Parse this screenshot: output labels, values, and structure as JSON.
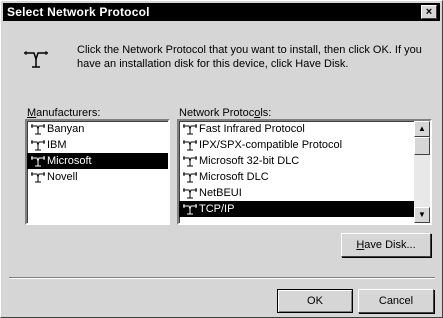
{
  "window": {
    "title": "Select Network Protocol",
    "close_label": "×"
  },
  "instructions": "Click the Network Protocol that you want to install, then click OK. If you have an installation disk for this device, click Have Disk.",
  "manufacturers": {
    "label_prefix": "",
    "label_underlined": "M",
    "label_rest": "anufacturers:",
    "items": [
      {
        "label": "Banyan",
        "icon": "network-protocol-icon"
      },
      {
        "label": "IBM",
        "icon": "network-protocol-icon"
      },
      {
        "label": "Microsoft",
        "icon": "network-protocol-icon"
      },
      {
        "label": "Novell",
        "icon": "network-protocol-icon"
      }
    ],
    "selected": "Microsoft"
  },
  "protocols": {
    "label_prefix": "Network Protoc",
    "label_underlined": "o",
    "label_rest": "ls:",
    "items": [
      {
        "label": "Fast Infrared Protocol",
        "icon": "network-protocol-icon"
      },
      {
        "label": "IPX/SPX-compatible Protocol",
        "icon": "network-protocol-icon"
      },
      {
        "label": "Microsoft 32-bit DLC",
        "icon": "network-protocol-icon"
      },
      {
        "label": "Microsoft DLC",
        "icon": "network-protocol-icon"
      },
      {
        "label": "NetBEUI",
        "icon": "network-protocol-icon"
      },
      {
        "label": "TCP/IP",
        "icon": "network-protocol-icon"
      }
    ],
    "selected": "TCP/IP"
  },
  "buttons": {
    "have_disk_underlined": "H",
    "have_disk_rest": "ave Disk...",
    "ok": "OK",
    "cancel": "Cancel"
  }
}
